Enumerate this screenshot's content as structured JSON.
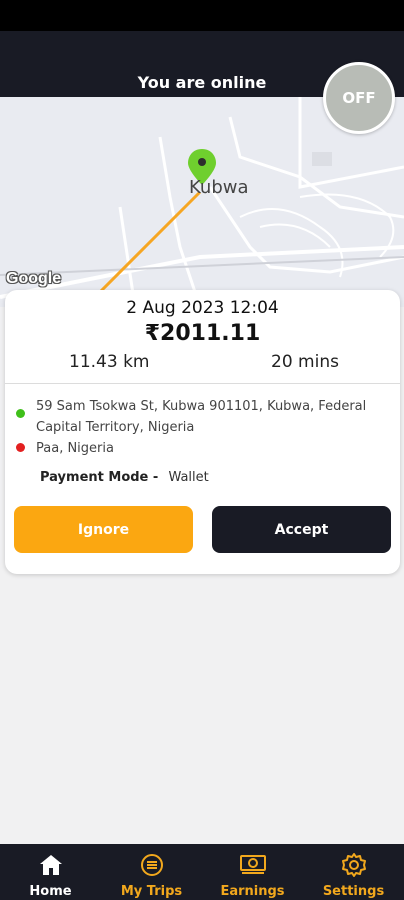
{
  "header": {
    "title": "You are online"
  },
  "status_toggle": {
    "label": "OFF"
  },
  "map": {
    "city_label": "Kubwa",
    "attribution": "Google",
    "pin_color": "#6fcf2e",
    "route_color": "#f6a623"
  },
  "trip_request": {
    "datetime": "2 Aug 2023 12:04",
    "amount": "₹2011.11",
    "distance": "11.43 km",
    "duration": "20 mins",
    "pickup_address": "59 Sam Tsokwa St, Kubwa 901101, Kubwa, Federal Capital Territory, Nigeria",
    "drop_address": "Paa, Nigeria",
    "payment_label": "Payment Mode -",
    "payment_value": "Wallet",
    "ignore_label": "Ignore",
    "accept_label": "Accept"
  },
  "bottom_nav": {
    "items": [
      {
        "label": "Home",
        "icon": "home-icon",
        "active": true
      },
      {
        "label": "My Trips",
        "icon": "trips-icon",
        "active": false
      },
      {
        "label": "Earnings",
        "icon": "earnings-icon",
        "active": false
      },
      {
        "label": "Settings",
        "icon": "settings-icon",
        "active": false
      }
    ]
  },
  "colors": {
    "header_bg": "#191b25",
    "accent": "#fba711",
    "nav_inactive": "#f2a81d"
  }
}
